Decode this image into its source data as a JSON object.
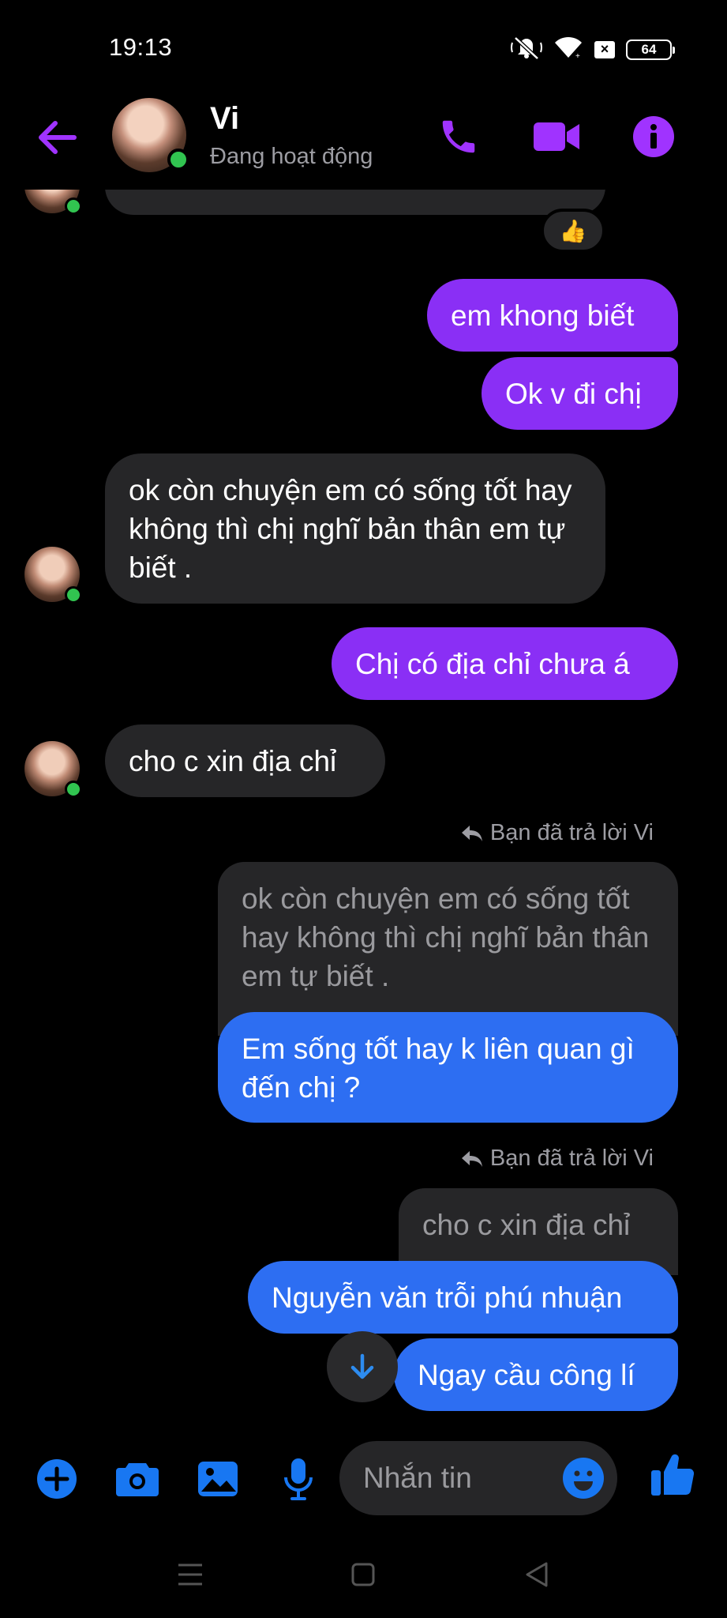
{
  "status_bar": {
    "time": "19:13",
    "battery": "64"
  },
  "header": {
    "name": "Vi",
    "status": "Đang hoạt động"
  },
  "colors": {
    "accent": "#a033ff",
    "purple_bubble": "#8a2ff5",
    "blue_bubble": "#2d6ef2",
    "incoming_bubble": "#262628",
    "online": "#31c450"
  },
  "reaction": "👍",
  "messages": [
    {
      "dir": "out",
      "text": "em khong biết"
    },
    {
      "dir": "out",
      "text": "Ok v đi chị"
    },
    {
      "dir": "in",
      "text": "ok còn chuyện em có sống tốt hay không thì chị nghĩ bản thân em tự biết ."
    },
    {
      "dir": "out",
      "text": "Chị có địa chỉ chưa á"
    },
    {
      "dir": "in",
      "text": "cho c xin địa chỉ"
    },
    {
      "dir": "out",
      "reply_label": "Bạn đã trả lời Vi",
      "quoted": "ok còn chuyện em có sống tốt hay không thì chị nghĩ bản thân em tự biết .",
      "text": "Em sống tốt hay k liên quan gì đến chị ?"
    },
    {
      "dir": "out",
      "reply_label": "Bạn đã trả lời Vi",
      "quoted": "cho c xin địa chỉ",
      "text": "Nguyễn văn trỗi phú nhuận"
    },
    {
      "dir": "out",
      "text": "Ngay cầu công lí"
    }
  ],
  "composer": {
    "placeholder": "Nhắn tin"
  }
}
